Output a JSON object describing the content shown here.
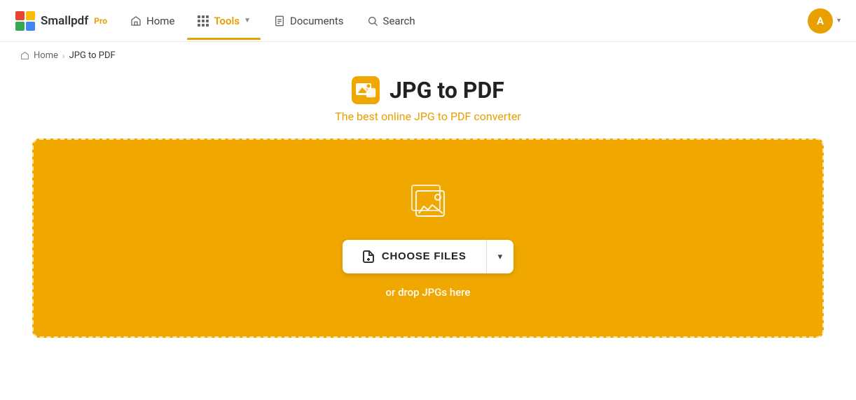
{
  "brand": {
    "name": "Smallpdf",
    "pro_label": "Pro",
    "logo_colors": [
      "#EA4335",
      "#FBBC04",
      "#34A853",
      "#4285F4"
    ]
  },
  "nav": {
    "home_label": "Home",
    "tools_label": "Tools",
    "documents_label": "Documents",
    "search_label": "Search",
    "active": "tools",
    "user_initial": "A"
  },
  "breadcrumb": {
    "home": "Home",
    "separator": "›",
    "current": "JPG to PDF"
  },
  "page": {
    "title": "JPG to PDF",
    "subtitle": "The best online JPG to PDF converter",
    "choose_files_label": "CHOOSE FILES",
    "drop_hint": "or drop JPGs here"
  },
  "colors": {
    "accent": "#f0a800",
    "brand_orange": "#e8a000",
    "drop_zone_bg": "#f0a800"
  }
}
